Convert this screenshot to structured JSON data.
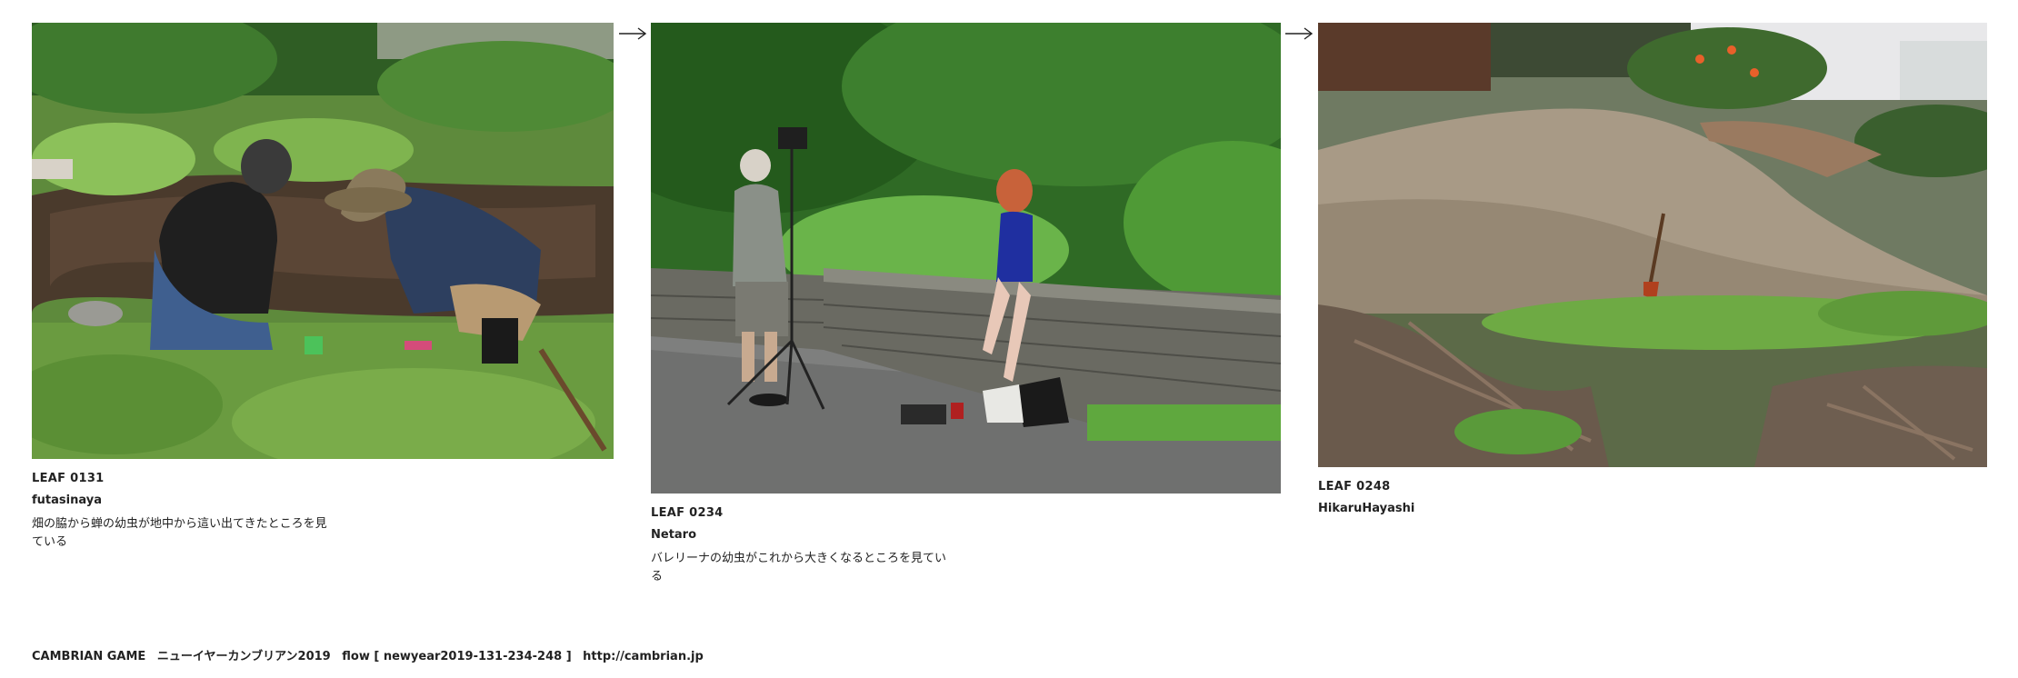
{
  "leaves": [
    {
      "id": "LEAF 0131",
      "author": "futasinaya",
      "caption": "畑の脇から蝉の幼虫が地中から這い出てきたところを見ている"
    },
    {
      "id": "LEAF 0234",
      "author": "Netaro",
      "caption": "バレリーナの幼虫がこれから大きくなるところを見ている"
    },
    {
      "id": "LEAF 0248",
      "author": "HikaruHayashi",
      "caption": ""
    }
  ],
  "footer": {
    "brand": "CAMBRIAN GAME",
    "event": "ニューイヤーカンブリアン2019",
    "flow": "flow [ newyear2019-131-234-248 ]",
    "url": "http://cambrian.jp"
  },
  "colors": {
    "text": "#222222",
    "background": "#ffffff"
  }
}
